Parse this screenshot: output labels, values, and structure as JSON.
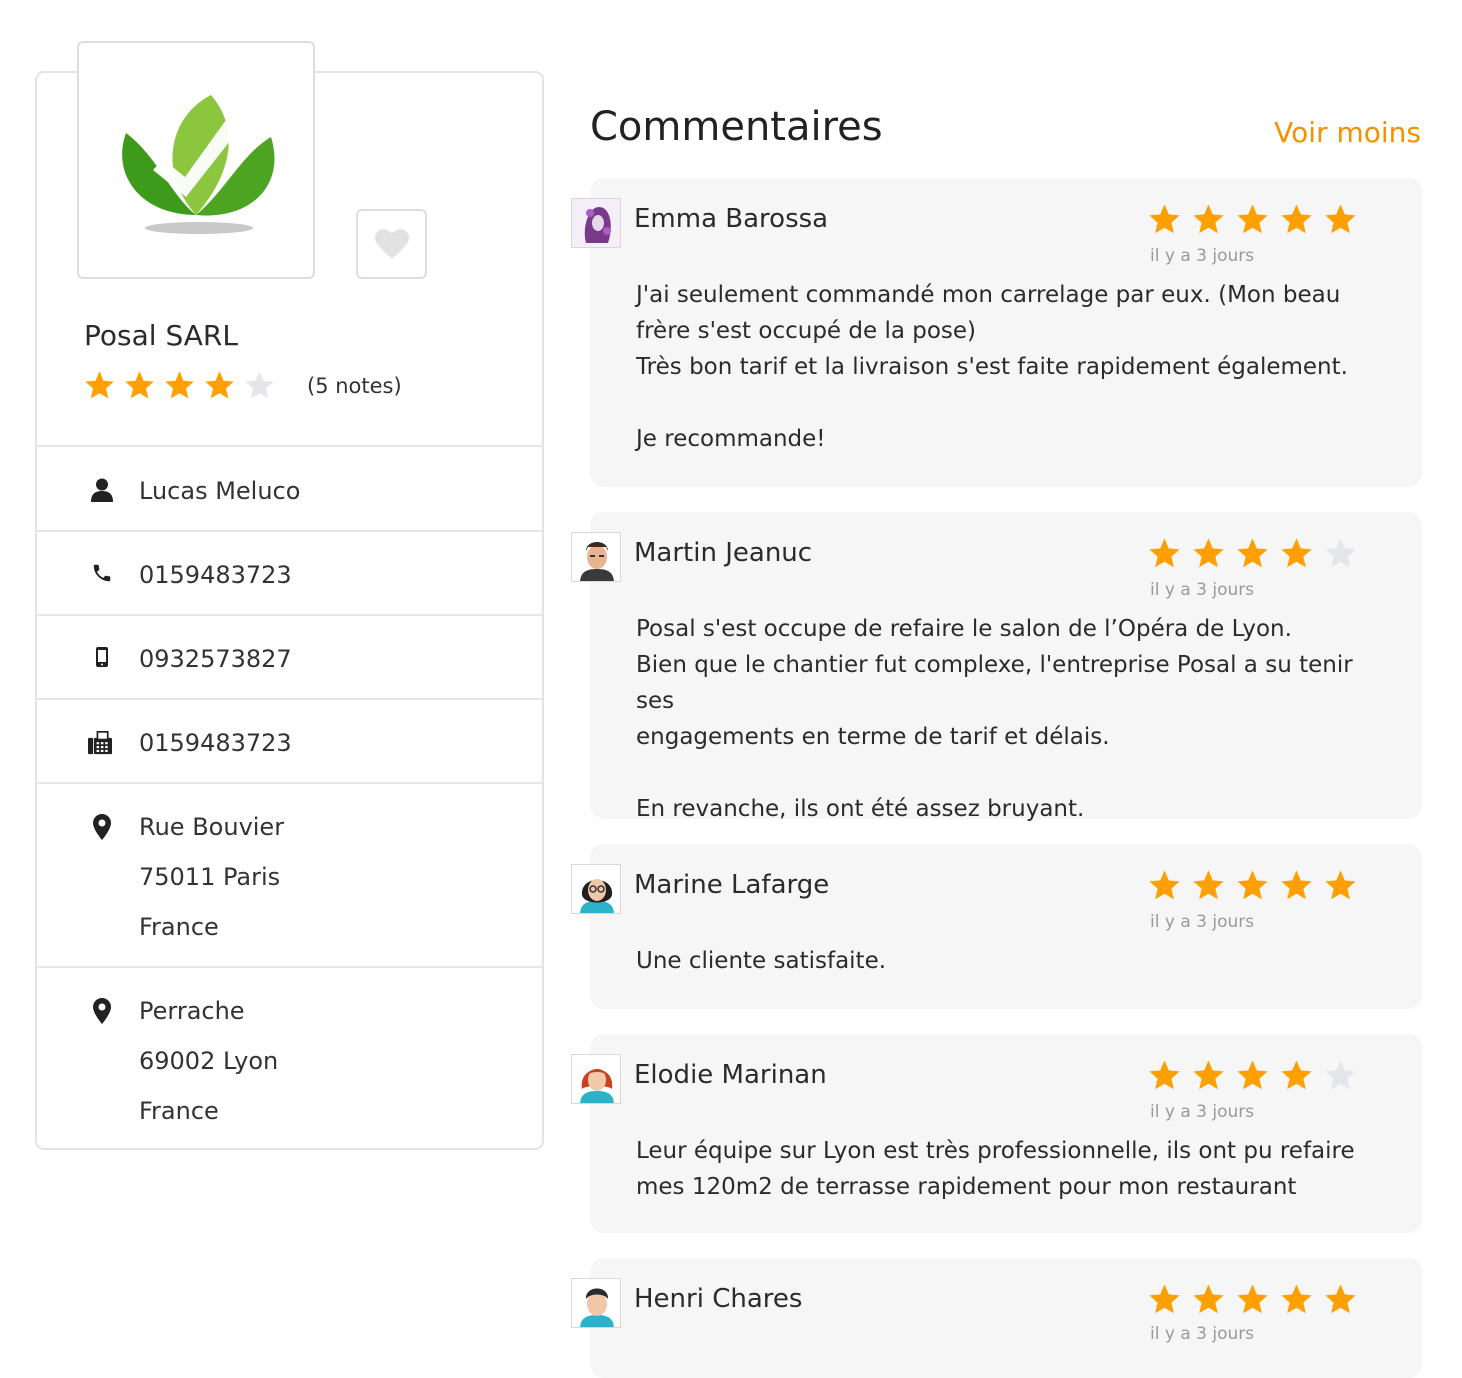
{
  "company": {
    "name": "Posal SARL",
    "rating": 4,
    "rating_max": 5,
    "notes_label": "(5 notes)",
    "logo_icon": "posal-leaf-check-logo",
    "favorite_icon": "heart-icon"
  },
  "contact": {
    "person": "Lucas Meluco",
    "phone": "0159483723",
    "mobile": "0932573827",
    "fax": "0159483723",
    "addresses": [
      {
        "line1": "Rue Bouvier",
        "line2": "75011 Paris",
        "line3": "France"
      },
      {
        "line1": "Perrache",
        "line2": "69002 Lyon",
        "line3": "France"
      }
    ]
  },
  "reviews_section": {
    "title": "Commentaires",
    "toggle_label": "Voir moins"
  },
  "reviews": [
    {
      "author": "Emma Barossa",
      "stars": 5,
      "date": "il y a 3 jours",
      "text": "J'ai seulement commandé mon carrelage par eux. (Mon beau\nfrère s'est occupé de la pose)\nTrès bon tarif et la livraison s'est faite rapidement également.\n\nJe recommande!"
    },
    {
      "author": "Martin Jeanuc",
      "stars": 4,
      "date": "il y a 3 jours",
      "text": "Posal s'est occupe de refaire le salon de l’Opéra de Lyon.\nBien que le chantier fut complexe, l'entreprise Posal a su tenir ses\nengagements en terme de tarif et délais.\n\nEn revanche, ils ont été assez bruyant."
    },
    {
      "author": "Marine Lafarge",
      "stars": 5,
      "date": "il y a 3 jours",
      "text": "Une cliente satisfaite."
    },
    {
      "author": "Elodie Marinan",
      "stars": 4,
      "date": "il y a 3 jours",
      "text": "Leur équipe sur Lyon est très professionnelle, ils ont pu refaire\nmes 120m2 de terrasse rapidement pour mon restaurant"
    },
    {
      "author": "Henri Chares",
      "stars": 5,
      "date": "il y a 3 jours",
      "text": ""
    }
  ],
  "colors": {
    "accent": "#f39200",
    "star_on": "#ffa000",
    "star_off": "#e4e6ea",
    "review_bg": "#f6f6f6"
  }
}
